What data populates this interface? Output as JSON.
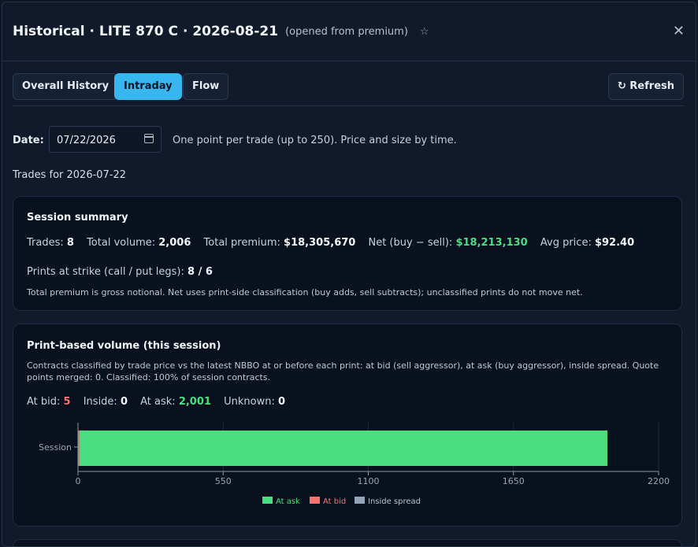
{
  "header": {
    "title": "Historical · LITE 870 C · 2026-08-21",
    "subtitle": "(opened from premium)",
    "star": "☆",
    "close": "✕"
  },
  "tabs": [
    {
      "label": "Overall History",
      "active": false
    },
    {
      "label": "Intraday",
      "active": true
    },
    {
      "label": "Flow",
      "active": false
    }
  ],
  "refresh_label": "↻ Refresh",
  "date": {
    "label": "Date:",
    "value": "07/22/2026",
    "hint": "One point per trade (up to 250). Price and size by time."
  },
  "trades_for": "Trades for 2026-07-22",
  "session_summary": {
    "title": "Session summary",
    "trades_label": "Trades:",
    "trades": "8",
    "volume_label": "Total volume:",
    "volume": "2,006",
    "premium_label": "Total premium:",
    "premium": "$18,305,670",
    "net_label": "Net (buy − sell):",
    "net": "$18,213,130",
    "avg_label": "Avg price:",
    "avg": "$92.40",
    "prints_label": "Prints at strike (call / put legs):",
    "prints": "8 / 6",
    "note": "Total premium is gross notional. Net uses print-side classification (buy adds, sell subtracts); unclassified prints do not move net."
  },
  "print_volume": {
    "title": "Print-based volume (this session)",
    "desc": "Contracts classified by trade price vs the latest NBBO at or before each print: at bid (sell aggressor), at ask (buy aggressor), inside spread. Quote points merged: 0. Classified: 100% of session contracts.",
    "at_bid_label": "At bid:",
    "at_bid": "5",
    "inside_label": "Inside:",
    "inside": "0",
    "at_ask_label": "At ask:",
    "at_ask": "2,001",
    "unknown_label": "Unknown:",
    "unknown": "0"
  },
  "chart_data": {
    "type": "bar",
    "orientation": "horizontal",
    "stacked": true,
    "categories": [
      "Session"
    ],
    "series": [
      {
        "name": "At ask",
        "values": [
          2001
        ],
        "color": "#4ade80"
      },
      {
        "name": "At bid",
        "values": [
          5
        ],
        "color": "#f87171"
      },
      {
        "name": "Inside spread",
        "values": [
          0
        ],
        "color": "#94a3b8"
      }
    ],
    "xlim": [
      0,
      2200
    ],
    "xticks": [
      0,
      550,
      1100,
      1650,
      2200
    ],
    "legend_position": "bottom",
    "grid": true
  }
}
